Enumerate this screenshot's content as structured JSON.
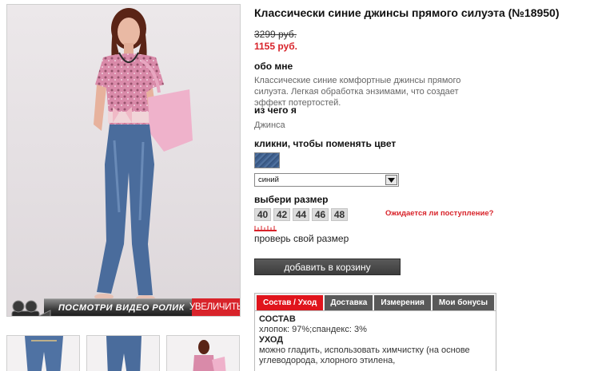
{
  "product": {
    "title": "Классически синие джинсы прямого силуэта (№18950)",
    "old_price": "3299 руб.",
    "new_price": "1155 руб."
  },
  "about": {
    "heading": "обо мне",
    "text": "Классические синие комфортные джинсы прямого силуэта. Легкая обработка энзимами, что создает эффект потертостей."
  },
  "material": {
    "heading": "из чего я",
    "text": "Джинса"
  },
  "color": {
    "heading": "кликни, чтобы поменять цвет",
    "selected": "синий",
    "swatch_color": "#3e5f8e"
  },
  "size": {
    "heading": "выбери размер",
    "options": [
      "40",
      "42",
      "44",
      "46",
      "48"
    ],
    "waiting_link": "Ожидается ли поступление?",
    "check_size_link": "проверь свой размер"
  },
  "cart": {
    "button_label": "добавить в корзину"
  },
  "photo": {
    "video_label": "ПОСМОТРИ ВИДЕО РОЛИК",
    "zoom_label": "УВЕЛИЧИТЬ"
  },
  "tabs": {
    "items": [
      "Состав / Уход",
      "Доставка",
      "Измерения",
      "Мои бонусы"
    ],
    "active": 0,
    "composition_heading": "СОСТАВ",
    "composition_text": "хлопок: 97%;спандекс: 3%",
    "care_heading": "УХОД",
    "care_text_1": "можно гладить, использовать химчистку (на основе",
    "care_text_2": "углеводорода, хлорного этилена,"
  },
  "colors": {
    "accent": "#d8232a",
    "tab_active": "#e0141c",
    "tab_inactive": "#595959",
    "button": "#4a4a4a"
  }
}
